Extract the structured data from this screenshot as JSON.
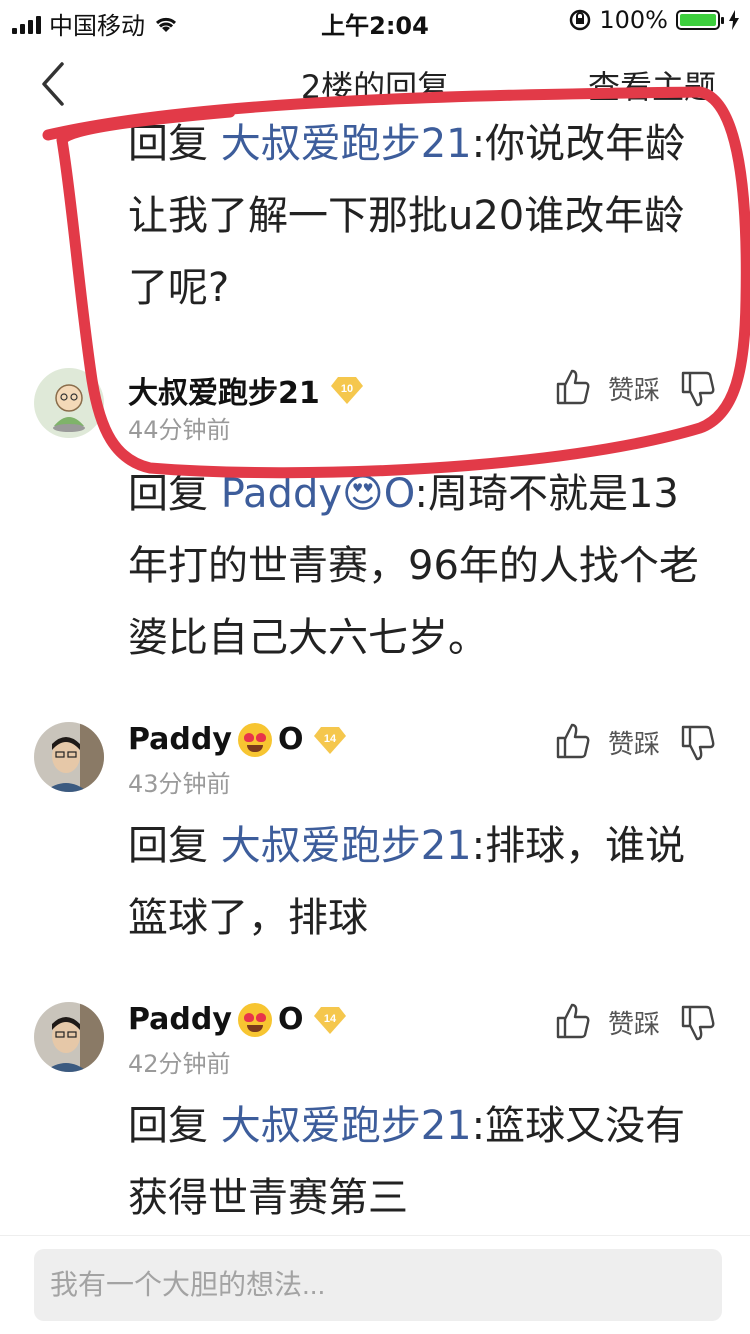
{
  "status_bar": {
    "carrier": "中国移动",
    "time": "上午2:04",
    "battery_percent": "100%"
  },
  "nav": {
    "title": "2楼的回复",
    "action": "查看主题"
  },
  "replies": [
    {
      "prefix": "回复 ",
      "mention": "大叔爱跑步21",
      "text": ":你说改年龄让我了解一下那批u20谁改年龄了呢?"
    },
    {
      "prefix": "回复 ",
      "mention": "Paddy😍O",
      "text": ":周琦不就是13年打的世青赛，96年的人找个老婆比自己大六七岁。"
    },
    {
      "prefix": "回复 ",
      "mention": "大叔爱跑步21",
      "text": ":排球，谁说篮球了，排球"
    },
    {
      "prefix": "回复 ",
      "mention": "大叔爱跑步21",
      "text": ":篮球又没有获得世青赛第三"
    }
  ],
  "comments": [
    {
      "name": "大叔爱跑步21",
      "level": "10",
      "time": "44分钟前",
      "vote_label": "赞踩"
    },
    {
      "name_a": "Paddy",
      "name_b": "O",
      "level": "14",
      "time": "43分钟前",
      "vote_label": "赞踩"
    },
    {
      "name_a": "Paddy",
      "name_b": "O",
      "level": "14",
      "time": "42分钟前",
      "vote_label": "赞踩"
    }
  ],
  "input": {
    "placeholder": "我有一个大胆的想法..."
  },
  "colors": {
    "mention": "#3d5d9b",
    "annotation": "#e23a48",
    "badge": "#f5c74d"
  }
}
